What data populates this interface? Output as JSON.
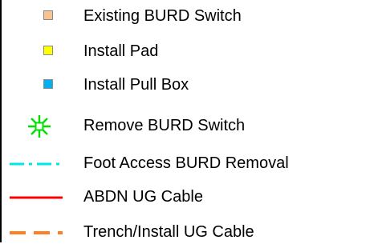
{
  "legend": {
    "items": [
      {
        "label": "Existing BURD Switch",
        "symbol": "square",
        "icon": "existing-switch-icon",
        "color": "#f7c48f"
      },
      {
        "label": "Install Pad",
        "symbol": "square",
        "icon": "pad-icon",
        "color": "#ffff00"
      },
      {
        "label": "Install Pull Box",
        "symbol": "square",
        "icon": "pull-box-icon",
        "color": "#00b0f0"
      },
      {
        "label": "Remove BURD Switch",
        "symbol": "burst",
        "icon": "remove-switch-icon",
        "color": "#00e000"
      },
      {
        "label": "Foot Access BURD Removal",
        "symbol": "dash-dot-line",
        "icon": "foot-access-line-icon",
        "color": "#00e5e5"
      },
      {
        "label": "ABDN UG Cable",
        "symbol": "solid-line",
        "icon": "abdn-cable-line-icon",
        "color": "#ff0000"
      },
      {
        "label": "Trench/Install UG Cable",
        "symbol": "dashed-line",
        "icon": "trench-cable-line-icon",
        "color": "#ff7f27"
      }
    ]
  }
}
